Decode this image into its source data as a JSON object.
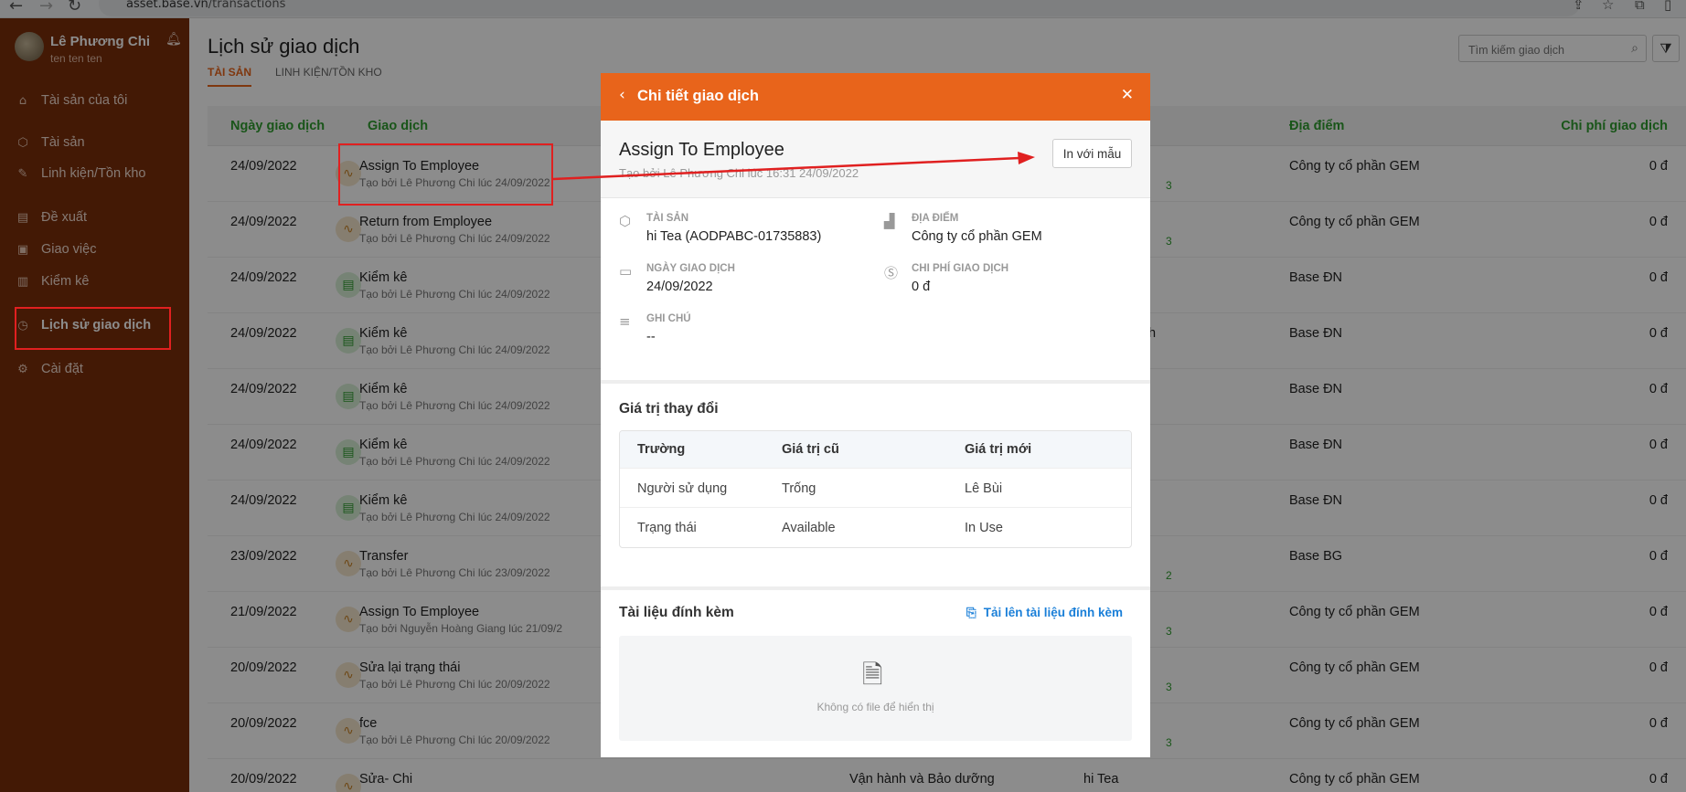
{
  "browser": {
    "url_host": "asset.base.vn",
    "url_path": "/transactions"
  },
  "sidebar": {
    "user_name": "Lê Phương Chi",
    "user_sub": "ten ten ten",
    "items": [
      {
        "label": "Tài sản của tôi",
        "icon": "home-icon"
      },
      {
        "label": "Tài sản",
        "icon": "box-icon"
      },
      {
        "label": "Linh kiện/Tồn kho",
        "icon": "tools-icon"
      },
      {
        "label": "Đề xuất",
        "icon": "document-icon"
      },
      {
        "label": "Giao việc",
        "icon": "clipboard-icon"
      },
      {
        "label": "Kiểm kê",
        "icon": "inventory-icon"
      },
      {
        "label": "Lịch sử giao dịch",
        "icon": "history-icon",
        "active": true
      },
      {
        "label": "Cài đặt",
        "icon": "gear-icon"
      }
    ]
  },
  "header": {
    "title": "Lịch sử giao dịch",
    "tabs": [
      "TÀI SẢN",
      "LINH KIỆN/TỒN KHO"
    ],
    "search_placeholder": "Tìm kiếm giao dịch"
  },
  "table": {
    "columns": [
      "Ngày giao dịch",
      "Giao dịch",
      "Địa điểm",
      "Chi phí giao dịch"
    ],
    "rows": [
      {
        "date": "24/09/2022",
        "name": "Assign To Employee",
        "sub": "Tạo bởi Lê Phương Chi lúc 24/09/2022",
        "type": "activity",
        "mid": "",
        "asset": "",
        "small": "3",
        "location": "Công ty cổ phần GEM",
        "cost": "0 đ"
      },
      {
        "date": "24/09/2022",
        "name": "Return from Employee",
        "sub": "Tạo bởi Lê Phương Chi lúc 24/09/2022",
        "type": "activity",
        "mid": "",
        "asset": "",
        "small": "3",
        "location": "Công ty cổ phần GEM",
        "cost": "0 đ"
      },
      {
        "date": "24/09/2022",
        "name": "Kiểm kê",
        "sub": "Tạo bởi Lê Phương Chi lúc 24/09/2022",
        "type": "inventory",
        "mid": "",
        "asset": "nh Dell",
        "small": "",
        "location": "Base ĐN",
        "cost": "0 đ"
      },
      {
        "date": "24/09/2022",
        "name": "Kiểm kê",
        "sub": "Tạo bởi Lê Phương Chi lúc 24/09/2022",
        "type": "inventory",
        "mid": "",
        "asset": "ính Logitech",
        "small": "",
        "location": "Base ĐN",
        "cost": "0 đ"
      },
      {
        "date": "24/09/2022",
        "name": "Kiểm kê",
        "sub": "Tạo bởi Lê Phương Chi lúc 24/09/2022",
        "type": "inventory",
        "mid": "",
        "asset": "ase",
        "small": "",
        "location": "Base ĐN",
        "cost": "0 đ"
      },
      {
        "date": "24/09/2022",
        "name": "Kiểm kê",
        "sub": "Tạo bởi Lê Phương Chi lúc 24/09/2022",
        "type": "inventory",
        "mid": "",
        "asset": "E2216H",
        "small": "",
        "location": "Base ĐN",
        "cost": "0 đ"
      },
      {
        "date": "24/09/2022",
        "name": "Kiểm kê",
        "sub": "Tạo bởi Lê Phương Chi lúc 24/09/2022",
        "type": "inventory",
        "mid": "",
        "asset": "",
        "small": "",
        "location": "Base ĐN",
        "cost": "0 đ"
      },
      {
        "date": "23/09/2022",
        "name": "Transfer",
        "sub": "Tạo bởi Lê Phương Chi lúc 23/09/2022",
        "type": "activity",
        "mid": "",
        "asset": "",
        "small": "2",
        "location": "Base BG",
        "cost": "0 đ"
      },
      {
        "date": "21/09/2022",
        "name": "Assign To Employee",
        "sub": "Tạo bởi Nguyễn Hoàng Giang lúc 21/09/2",
        "type": "activity",
        "mid": "",
        "asset": "",
        "small": "3",
        "location": "Công ty cổ phần GEM",
        "cost": "0 đ"
      },
      {
        "date": "20/09/2022",
        "name": "Sửa lại trạng thái",
        "sub": "Tạo bởi Lê Phương Chi lúc 20/09/2022",
        "type": "activity",
        "mid": "",
        "asset": "",
        "small": "3",
        "location": "Công ty cổ phần GEM",
        "cost": "0 đ"
      },
      {
        "date": "20/09/2022",
        "name": "fce",
        "sub": "Tạo bởi Lê Phương Chi lúc 20/09/2022",
        "type": "activity",
        "mid": "",
        "asset": "",
        "small": "3",
        "location": "Công ty cổ phần GEM",
        "cost": "0 đ"
      },
      {
        "date": "20/09/2022",
        "name": "Sửa- Chi",
        "sub": "",
        "type": "activity",
        "mid": "Vận hành và Bảo dưỡng",
        "asset": "hi Tea",
        "small": "",
        "location": "Công ty cổ phần GEM",
        "cost": "0 đ"
      }
    ]
  },
  "modal": {
    "title": "Chi tiết giao dịch",
    "name": "Assign To Employee",
    "created_by": "Tạo bởi Lê Phương Chi lúc 16:31 24/09/2022",
    "print_label": "In với mẫu",
    "asset_label": "TÀI SẢN",
    "asset_value": "hi Tea (AODPABC-01735883)",
    "location_label": "ĐỊA ĐIỂM",
    "location_value": "Công ty cổ phần GEM",
    "date_label": "NGÀY GIAO DỊCH",
    "date_value": "24/09/2022",
    "cost_label": "CHI PHÍ GIAO DỊCH",
    "cost_value": "0 đ",
    "note_label": "GHI CHÚ",
    "note_value": "--",
    "changes_title": "Giá trị thay đổi",
    "changes_columns": [
      "Trường",
      "Giá trị cũ",
      "Giá trị mới"
    ],
    "changes_rows": [
      [
        "Người sử dụng",
        "Trống",
        "Lê Bùi"
      ],
      [
        "Trạng thái",
        "Available",
        "In Use"
      ]
    ],
    "attachments_title": "Tài liệu đính kèm",
    "upload_label": "Tải lên tài liệu đính kèm",
    "empty_text": "Không có file để hiển thị"
  },
  "colors": {
    "sidebar": "#7a2e0a",
    "accent": "#e8641b",
    "header_green": "#2e9b2e",
    "annotation_red": "#e02020",
    "link_blue": "#1a7fd8"
  }
}
